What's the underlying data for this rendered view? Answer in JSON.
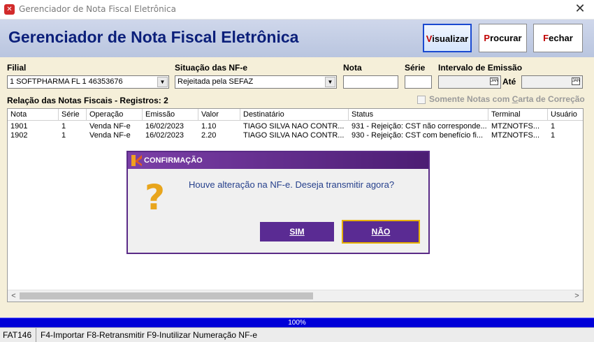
{
  "window": {
    "title": "Gerenciador de Nota Fiscal Eletrônica",
    "close_glyph": "✕"
  },
  "header": {
    "title": "Gerenciador de Nota Fiscal Eletrônica",
    "buttons": {
      "visualizar": {
        "hotkey": "V",
        "rest": "isualizar"
      },
      "procurar": {
        "hotkey": "P",
        "rest": "rocurar"
      },
      "fechar": {
        "hotkey": "F",
        "rest": "echar"
      }
    }
  },
  "filters": {
    "filial_label": "Filial",
    "filial_value": "1  SOFTPHARMA FL 1                 46353676",
    "situacao_label": "Situação das NF-e",
    "situacao_value": "Rejeitada pela SEFAZ",
    "nota_label": "Nota",
    "nota_value": "",
    "serie_label": "Série",
    "serie_value": "",
    "intervalo_label": "Intervalo de Emissão",
    "ate_label": "Até",
    "cal_glyph": "JAN"
  },
  "list": {
    "caption": "Relação das Notas Fiscais - Registros: 2",
    "checkbox_label_pre": "Somente Notas com ",
    "checkbox_label_hotkey": "C",
    "checkbox_label_post": "arta de Correção",
    "columns": [
      "Nota",
      "Série",
      "Operação",
      "Emissão",
      "Valor",
      "Destinatário",
      "Status",
      "Terminal",
      "Usuário"
    ],
    "rows": [
      [
        "1901",
        "1",
        "Venda NF-e",
        "16/02/2023",
        "1.10",
        "TIAGO SILVA NAO CONTR...",
        "931 - Rejeição: CST não corresponde...",
        "MTZNOTFS...",
        "1"
      ],
      [
        "1902",
        "1",
        "Venda NF-e",
        "16/02/2023",
        "2.20",
        "TIAGO SILVA NAO CONTR...",
        "930 - Rejeição: CST com benefício fi...",
        "MTZNOTFS...",
        "1"
      ]
    ],
    "scroll_left": "<",
    "scroll_right": ">"
  },
  "progress": {
    "label": "100%",
    "percent": 100
  },
  "statusbar": {
    "code": "FAT146",
    "hints": "F4-Importar  F8-Retransmitir  F9-Inutilizar Numeração NF-e"
  },
  "dialog": {
    "title": "CONFIRMAÇÃO",
    "icon": "?",
    "message": "Houve alteração na NF-e. Deseja transmitir agora?",
    "yes_label": "SIM",
    "no_label": "NÃO"
  },
  "colors": {
    "header_title": "#0b1f7a",
    "dialog_purple": "#5a2b93",
    "progress_blue": "#0000d8",
    "question_mark": "#e8a51c"
  }
}
